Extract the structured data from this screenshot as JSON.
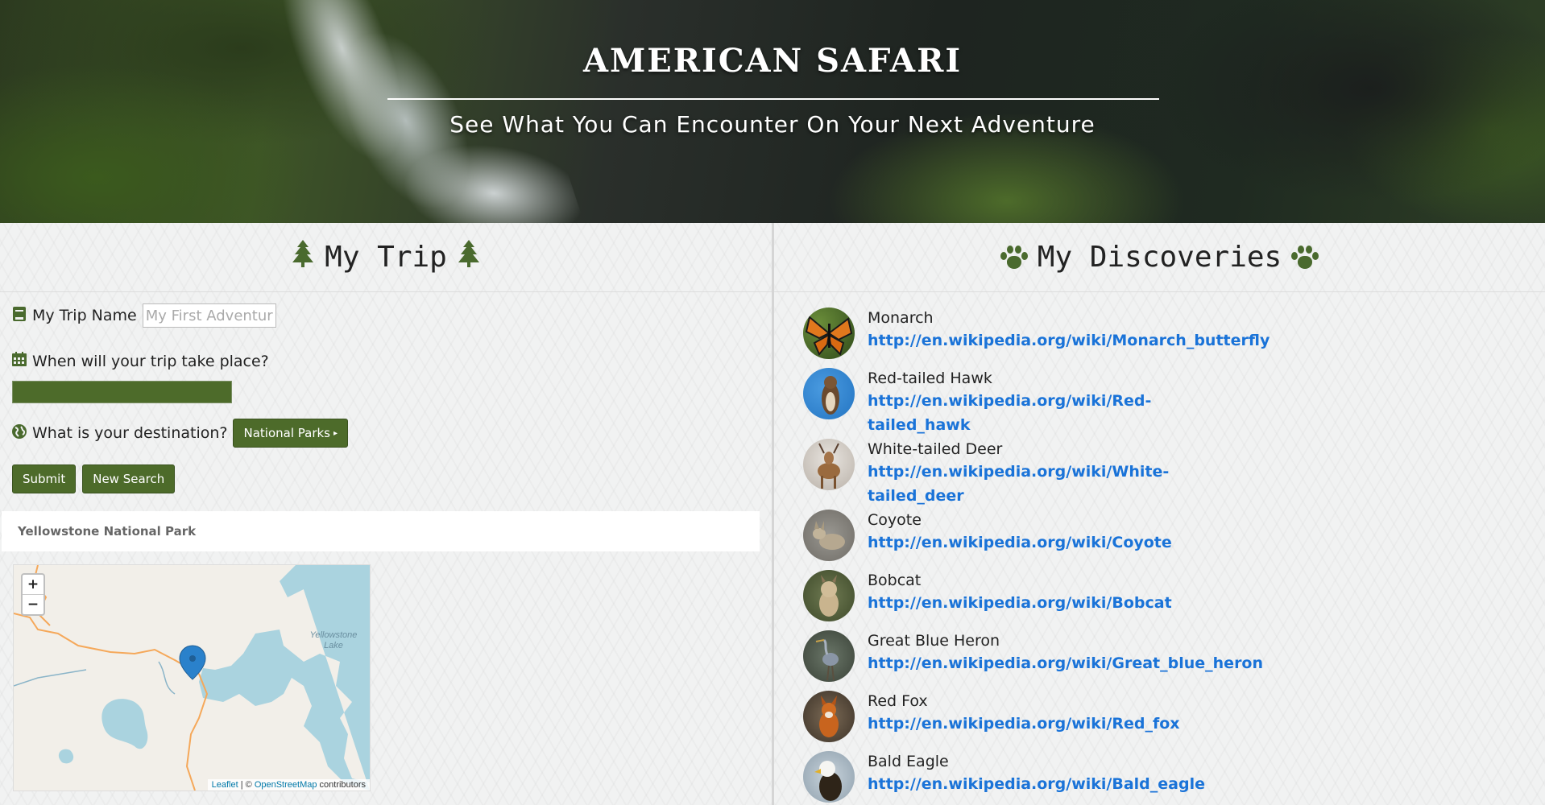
{
  "header": {
    "title": "AMERICAN SAFARI",
    "subtitle": "See What You Can Encounter On Your Next Adventure"
  },
  "trip": {
    "heading": "My Trip",
    "heading_icon": "tree-icon",
    "name_label": "My Trip Name",
    "name_placeholder": "My First Adventure",
    "date_label": "When will your trip take place?",
    "destination_label": "What is your destination?",
    "destination_button": "National Parks",
    "submit_label": "Submit",
    "new_search_label": "New Search",
    "selected_park": "Yellowstone National Park",
    "accent_color": "#4d6b2a"
  },
  "map": {
    "lake_label": "Yellowstone Lake",
    "zoom_in": "+",
    "zoom_out": "−",
    "attribution_leaflet": "Leaflet",
    "attribution_sep": " | © ",
    "attribution_osm": "OpenStreetMap",
    "attribution_suffix": " contributors"
  },
  "discoveries": {
    "heading": "My Discoveries",
    "heading_icon": "paw-icon",
    "items": [
      {
        "name": "Monarch",
        "link_line1": "http://en.wikipedia.org/wiki/Monarch_butterfly",
        "link_line2": ""
      },
      {
        "name": "Red-tailed Hawk",
        "link_line1": "http://en.wikipedia.org/wiki/Red-",
        "link_line2": "tailed_hawk"
      },
      {
        "name": "White-tailed Deer",
        "link_line1": "http://en.wikipedia.org/wiki/White-",
        "link_line2": "tailed_deer"
      },
      {
        "name": "Coyote",
        "link_line1": "http://en.wikipedia.org/wiki/Coyote",
        "link_line2": ""
      },
      {
        "name": "Bobcat",
        "link_line1": "http://en.wikipedia.org/wiki/Bobcat",
        "link_line2": ""
      },
      {
        "name": "Great Blue Heron",
        "link_line1": "http://en.wikipedia.org/wiki/Great_blue_heron",
        "link_line2": ""
      },
      {
        "name": "Red Fox",
        "link_line1": "http://en.wikipedia.org/wiki/Red_fox",
        "link_line2": ""
      },
      {
        "name": "Bald Eagle",
        "link_line1": "http://en.wikipedia.org/wiki/Bald_eagle",
        "link_line2": ""
      }
    ]
  }
}
